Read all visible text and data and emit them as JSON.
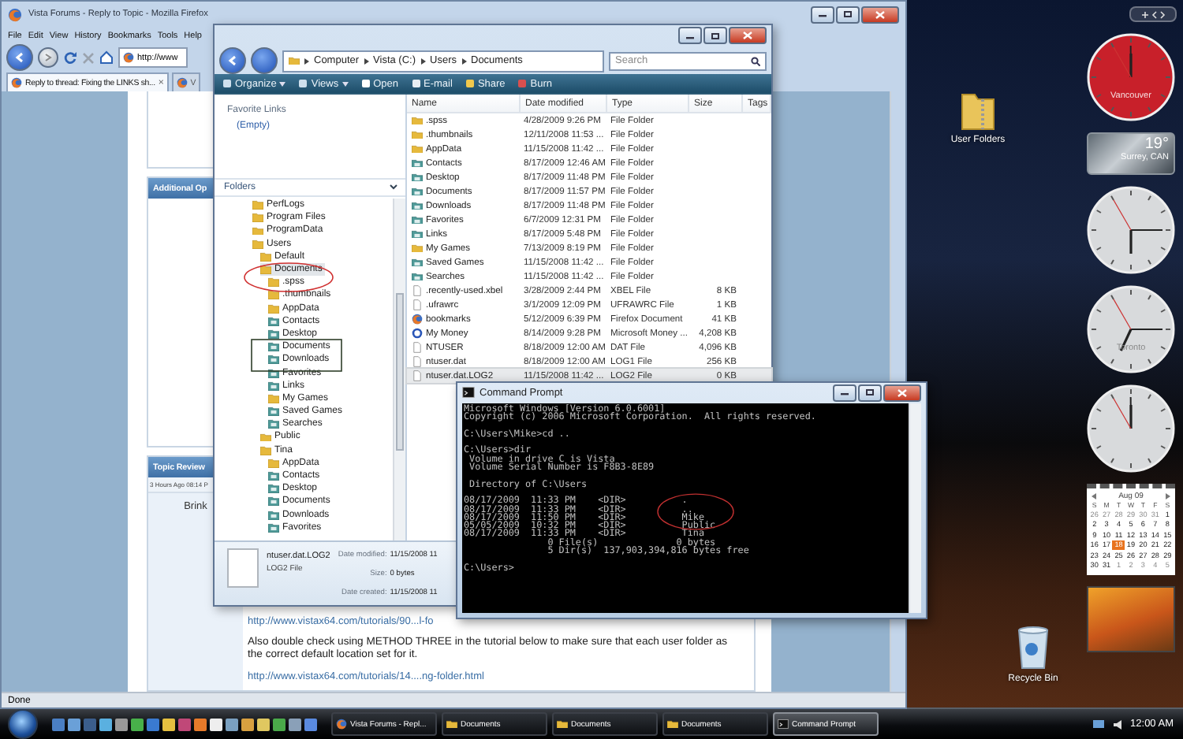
{
  "firefox": {
    "title": "Vista Forums - Reply to Topic - Mozilla Firefox",
    "menu": [
      "File",
      "Edit",
      "View",
      "History",
      "Bookmarks",
      "Tools",
      "Help"
    ],
    "address": "http://www",
    "tabs": [
      {
        "label": "Reply to thread: Fixing the LINKS sh...",
        "close": "×",
        "selected": true
      },
      {
        "label": "V",
        "selected": false
      }
    ],
    "additional_header": "Additional Op",
    "topic_review": {
      "title": "Topic Review",
      "meta": "3 Hours Ago 08:14 P",
      "author": "Brink",
      "post": [
        {
          "kind": "link",
          "text": "http://www.vistax64.com/tutorials/90...l-fo"
        },
        {
          "kind": "text",
          "text": "Also double check using METHOD THREE in the tutorial below to make sure that each user folder as the correct default location set for it."
        },
        {
          "kind": "link",
          "text": "http://www.vistax64.com/tutorials/14....ng-folder.html"
        }
      ]
    },
    "status": "Done"
  },
  "explorer": {
    "breadcrumb": [
      "Computer",
      "Vista (C:)",
      "Users",
      "Documents"
    ],
    "search": {
      "placeholder": "Search"
    },
    "toolbar": [
      {
        "label": "Organize",
        "dropdown": true
      },
      {
        "label": "Views",
        "dropdown": true
      },
      {
        "label": "Open",
        "dropdown": false
      },
      {
        "label": "E-mail",
        "dropdown": false
      },
      {
        "label": "Share",
        "dropdown": false
      },
      {
        "label": "Burn",
        "dropdown": false
      }
    ],
    "favorite_links": {
      "title": "Favorite Links",
      "items": [
        "(Empty)"
      ]
    },
    "folders_title": "Folders",
    "tree": [
      {
        "label": "PerfLogs",
        "kind": "folder",
        "selected": false
      },
      {
        "label": "Program Files",
        "kind": "folder",
        "selected": false
      },
      {
        "label": "ProgramData",
        "kind": "folder",
        "selected": false
      },
      {
        "label": "Users",
        "kind": "folder",
        "selected": false,
        "children": [
          {
            "label": "Default",
            "kind": "folder",
            "selected": false
          },
          {
            "label": "Documents",
            "kind": "folder",
            "selected": true,
            "children": [
              {
                "label": ".spss",
                "kind": "folder",
                "selected": false
              },
              {
                "label": ".thumbnails",
                "kind": "folder",
                "selected": false
              },
              {
                "label": "AppData",
                "kind": "folder",
                "selected": false
              },
              {
                "label": "Contacts",
                "kind": "special",
                "selected": false
              },
              {
                "label": "Desktop",
                "kind": "special",
                "selected": false
              },
              {
                "label": "Documents",
                "kind": "special",
                "selected": false
              },
              {
                "label": "Downloads",
                "kind": "special",
                "selected": false
              },
              {
                "label": "Favorites",
                "kind": "special",
                "selected": false
              },
              {
                "label": "Links",
                "kind": "special",
                "selected": false
              },
              {
                "label": "My Games",
                "kind": "folder",
                "selected": false
              },
              {
                "label": "Saved Games",
                "kind": "special",
                "selected": false
              },
              {
                "label": "Searches",
                "kind": "special",
                "selected": false
              }
            ]
          },
          {
            "label": "Public",
            "kind": "folder",
            "selected": false
          },
          {
            "label": "Tina",
            "kind": "folder",
            "selected": false,
            "children": [
              {
                "label": "AppData",
                "kind": "folder",
                "selected": false
              },
              {
                "label": "Contacts",
                "kind": "special",
                "selected": false
              },
              {
                "label": "Desktop",
                "kind": "special",
                "selected": false
              },
              {
                "label": "Documents",
                "kind": "special",
                "selected": false
              },
              {
                "label": "Downloads",
                "kind": "special",
                "selected": false
              },
              {
                "label": "Favorites",
                "kind": "special",
                "selected": false
              }
            ]
          }
        ]
      }
    ],
    "columns": [
      "Name",
      "Date modified",
      "Type",
      "Size",
      "Tags"
    ],
    "rows": [
      {
        "name": ".spss",
        "date": "4/28/2009 9:26 PM",
        "type": "File Folder",
        "kind": "folder",
        "selected": false
      },
      {
        "name": ".thumbnails",
        "date": "12/11/2008 11:53 ...",
        "type": "File Folder",
        "kind": "folder",
        "selected": false
      },
      {
        "name": "AppData",
        "date": "11/15/2008 11:42 ...",
        "type": "File Folder",
        "kind": "folder",
        "selected": false
      },
      {
        "name": "Contacts",
        "date": "8/17/2009 12:46 AM",
        "type": "File Folder",
        "kind": "special",
        "selected": false
      },
      {
        "name": "Desktop",
        "date": "8/17/2009 11:48 PM",
        "type": "File Folder",
        "kind": "special",
        "selected": false
      },
      {
        "name": "Documents",
        "date": "8/17/2009 11:57 PM",
        "type": "File Folder",
        "kind": "special",
        "selected": false
      },
      {
        "name": "Downloads",
        "date": "8/17/2009 11:48 PM",
        "type": "File Folder",
        "kind": "special",
        "selected": false
      },
      {
        "name": "Favorites",
        "date": "6/7/2009 12:31 PM",
        "type": "File Folder",
        "kind": "special",
        "selected": false
      },
      {
        "name": "Links",
        "date": "8/17/2009 5:48 PM",
        "type": "File Folder",
        "kind": "special",
        "selected": false
      },
      {
        "name": "My Games",
        "date": "7/13/2009 8:19 PM",
        "type": "File Folder",
        "kind": "folder",
        "selected": false
      },
      {
        "name": "Saved Games",
        "date": "11/15/2008 11:42 ...",
        "type": "File Folder",
        "kind": "special",
        "selected": false
      },
      {
        "name": "Searches",
        "date": "11/15/2008 11:42 ...",
        "type": "File Folder",
        "kind": "special",
        "selected": false
      },
      {
        "name": ".recently-used.xbel",
        "date": "3/28/2009 2:44 PM",
        "type": "XBEL File",
        "size": "8 KB",
        "kind": "file",
        "selected": false
      },
      {
        "name": ".ufrawrc",
        "date": "3/1/2009 12:09 PM",
        "type": "UFRAWRC File",
        "size": "1 KB",
        "kind": "file",
        "selected": false
      },
      {
        "name": "bookmarks",
        "date": "5/12/2009 6:39 PM",
        "type": "Firefox Document",
        "size": "41 KB",
        "kind": "firefox",
        "selected": false
      },
      {
        "name": "My Money",
        "date": "8/14/2009 9:28 PM",
        "type": "Microsoft Money ...",
        "size": "4,208 KB",
        "kind": "money",
        "selected": false
      },
      {
        "name": "NTUSER",
        "date": "8/18/2009 12:00 AM",
        "type": "DAT File",
        "size": "4,096 KB",
        "kind": "file",
        "selected": false
      },
      {
        "name": "ntuser.dat",
        "date": "8/18/2009 12:00 AM",
        "type": "LOG1 File",
        "size": "256 KB",
        "kind": "file",
        "selected": false
      },
      {
        "name": "ntuser.dat.LOG2",
        "date": "11/15/2008 11:42 ...",
        "type": "LOG2 File",
        "size": "0 KB",
        "kind": "file",
        "selected": true
      }
    ],
    "details": {
      "name": "ntuser.dat.LOG2",
      "type": "LOG2 File",
      "fields": [
        {
          "label": "Date modified:",
          "value": "11/15/2008 11"
        },
        {
          "label": "Size:",
          "value": "0 bytes"
        },
        {
          "label": "Date created:",
          "value": "11/15/2008 11"
        }
      ]
    }
  },
  "command_prompt": {
    "title": "Command Prompt",
    "blocks": [
      [
        "Microsoft Windows [Version 6.0.6001]",
        "Copyright (c) 2006 Microsoft Corporation.  All rights reserved."
      ],
      [
        "C:\\Users\\Mike>cd .."
      ],
      [
        "C:\\Users>dir",
        " Volume in drive C is Vista",
        " Volume Serial Number is F8B3-8E89"
      ],
      [
        " Directory of C:\\Users"
      ],
      [
        "08/17/2009  11:33 PM    <DIR>          .",
        "08/17/2009  11:33 PM    <DIR>          ..",
        "08/17/2009  11:50 PM    <DIR>          Mike",
        "05/05/2009  10:32 PM    <DIR>          Public",
        "08/17/2009  11:33 PM    <DIR>          Tina",
        "               0 File(s)              0 bytes",
        "               5 Dir(s)  137,903,394,816 bytes free"
      ],
      [
        "C:\\Users>"
      ]
    ]
  },
  "desktop_icons": [
    {
      "label": "User Folders",
      "kind": "zip-folder"
    },
    {
      "label": "Recycle Bin",
      "kind": "bin"
    }
  ],
  "gadgets": [
    {
      "kind": "clock",
      "color": "#c8202a",
      "label": "Vancouver"
    },
    {
      "kind": "weather",
      "temperature": "19°",
      "place": "Surrey, CAN"
    },
    {
      "kind": "clock",
      "color": "#d8dadc"
    },
    {
      "kind": "clock",
      "color": "#d8dadc",
      "label": "Toronto"
    },
    {
      "kind": "clock",
      "color": "#d8dadc"
    },
    {
      "kind": "calendar",
      "month": "Aug 09",
      "weekdays": [
        "S",
        "M",
        "T",
        "W",
        "T",
        "F",
        "S"
      ],
      "days": [
        {
          "day": "26",
          "other_month": true,
          "selected": false
        },
        {
          "day": "27",
          "other_month": true,
          "selected": false
        },
        {
          "day": "28",
          "other_month": true,
          "selected": false
        },
        {
          "day": "29",
          "other_month": true,
          "selected": false
        },
        {
          "day": "30",
          "other_month": true,
          "selected": false
        },
        {
          "day": "31",
          "other_month": true,
          "selected": false
        },
        {
          "day": "1",
          "other_month": false,
          "selected": false
        },
        {
          "day": "2",
          "other_month": false,
          "selected": false
        },
        {
          "day": "3",
          "other_month": false,
          "selected": false
        },
        {
          "day": "4",
          "other_month": false,
          "selected": false
        },
        {
          "day": "5",
          "other_month": false,
          "selected": false
        },
        {
          "day": "6",
          "other_month": false,
          "selected": false
        },
        {
          "day": "7",
          "other_month": false,
          "selected": false
        },
        {
          "day": "8",
          "other_month": false,
          "selected": false
        },
        {
          "day": "9",
          "other_month": false,
          "selected": false
        },
        {
          "day": "10",
          "other_month": false,
          "selected": false
        },
        {
          "day": "11",
          "other_month": false,
          "selected": false
        },
        {
          "day": "12",
          "other_month": false,
          "selected": false
        },
        {
          "day": "13",
          "other_month": false,
          "selected": false
        },
        {
          "day": "14",
          "other_month": false,
          "selected": false
        },
        {
          "day": "15",
          "other_month": false,
          "selected": false
        },
        {
          "day": "16",
          "other_month": false,
          "selected": false
        },
        {
          "day": "17",
          "other_month": false,
          "selected": false
        },
        {
          "day": "18",
          "other_month": false,
          "selected": true
        },
        {
          "day": "19",
          "other_month": false,
          "selected": false
        },
        {
          "day": "20",
          "other_month": false,
          "selected": false
        },
        {
          "day": "21",
          "other_month": false,
          "selected": false
        },
        {
          "day": "22",
          "other_month": false,
          "selected": false
        },
        {
          "day": "23",
          "other_month": false,
          "selected": false
        },
        {
          "day": "24",
          "other_month": false,
          "selected": false
        },
        {
          "day": "25",
          "other_month": false,
          "selected": false
        },
        {
          "day": "26",
          "other_month": false,
          "selected": false
        },
        {
          "day": "27",
          "other_month": false,
          "selected": false
        },
        {
          "day": "28",
          "other_month": false,
          "selected": false
        },
        {
          "day": "29",
          "other_month": false,
          "selected": false
        },
        {
          "day": "30",
          "other_month": false,
          "selected": false
        },
        {
          "day": "31",
          "other_month": false,
          "selected": false
        },
        {
          "day": "1",
          "other_month": true,
          "selected": false
        },
        {
          "day": "2",
          "other_month": true,
          "selected": false
        },
        {
          "day": "3",
          "other_month": true,
          "selected": false
        },
        {
          "day": "4",
          "other_month": true,
          "selected": false
        },
        {
          "day": "5",
          "other_month": true,
          "selected": false
        }
      ]
    },
    {
      "kind": "slideshow"
    }
  ],
  "taskbar": {
    "tasks": [
      {
        "label": "Vista Forums - Repl...",
        "kind": "firefox",
        "selected": false
      },
      {
        "label": "Documents",
        "kind": "folder",
        "selected": false
      },
      {
        "label": "Documents",
        "kind": "folder",
        "selected": false
      },
      {
        "label": "Documents",
        "kind": "folder",
        "selected": false
      },
      {
        "label": "Command Prompt",
        "kind": "cmd",
        "selected": true
      }
    ],
    "clock": "12:00 AM"
  }
}
